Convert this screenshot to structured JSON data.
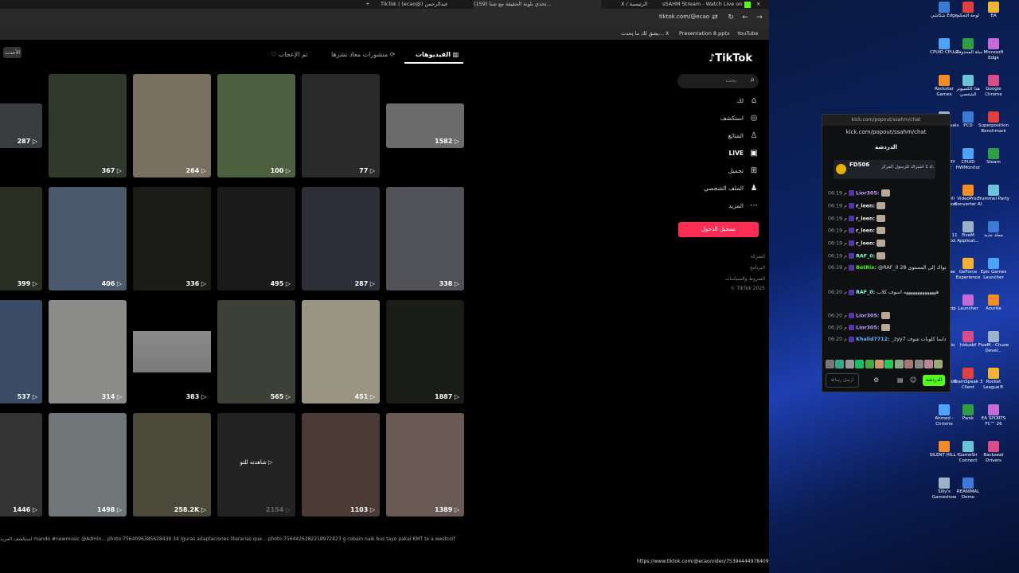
{
  "browser": {
    "tabs": [
      {
        "label": "TikTok | (ecao@) عبدالرحمن",
        "active": false
      },
      {
        "label": "(159) تحدي بلونة الحقيقة مع شنا...",
        "active": true
      },
      {
        "label": "X / الرئيسية",
        "active": false
      },
      {
        "label": "sSAHM Stream - Watch Live on",
        "active": false
      }
    ],
    "url": "tiktok.com/@ecao",
    "bookmarks": [
      "YouTube",
      "Presentation 8.pptx",
      "يشق لك ما يحدث... X"
    ],
    "status_url": "https://www.tiktok.com/@ecao/video/7539444497840990074"
  },
  "tiktok": {
    "logo": "TikTok",
    "search_placeholder": "بحث",
    "nav": [
      {
        "label": "لك",
        "icon": "home-icon"
      },
      {
        "label": "استكشف",
        "icon": "compass-icon"
      },
      {
        "label": "المتابَع",
        "icon": "user-follow-icon"
      },
      {
        "label": "LIVE",
        "icon": "live-icon"
      },
      {
        "label": "تحميل",
        "icon": "upload-icon"
      },
      {
        "label": "الملف الشخصي",
        "icon": "profile-icon"
      },
      {
        "label": "المزيد",
        "icon": "more-icon"
      }
    ],
    "login_label": "تسجيل الدخول",
    "footer": [
      "الشركة",
      "البرنامج",
      "الشروط والسياسات",
      "© TikTok 2025"
    ],
    "profile_tabs": {
      "videos": "الفيديوهات",
      "reposts": "منشورات معاد نشرها",
      "liked": "تم الإعجاب",
      "latest": "الأحدث"
    },
    "video_rows": [
      [
        "287",
        "367",
        "264",
        "100",
        "77",
        "1582"
      ],
      [
        "399",
        "406",
        "336",
        "495",
        "287",
        "338"
      ],
      [
        "537",
        "314",
        "383",
        "565",
        "451",
        "1887"
      ],
      [
        "1446",
        "1498",
        "258.2K",
        "2154",
        "1103",
        "1389"
      ]
    ],
    "watch_again_label": "شاهدته للتو",
    "bottom_strip": "استكشف المزيد   mando #newmusic @Admin...   photo:7564096385628439 34   Iguras adaptaciones literarias que...   photo:7564426382218972423   g cobain naik bus tayo pakai KMT   te a westcoif"
  },
  "kick": {
    "title": "sSAHM Stream - Watch Live on",
    "url": "kick.com/popout/ssahm/chat",
    "chat_header": "الدردشة",
    "pinned_user": "FD506",
    "pinned_text": "إهداء 1 اشتراك للرسول المركز",
    "messages": [
      {
        "time": "06:19 م",
        "user": "Lior305:",
        "text": "",
        "color": "#c59cff"
      },
      {
        "time": "06:19 م",
        "user": "r_leen:",
        "text": "",
        "color": "#f2f2f2"
      },
      {
        "time": "06:19 م",
        "user": "r_leen:",
        "text": "",
        "color": "#f2f2f2"
      },
      {
        "time": "06:19 م",
        "user": "r_leen:",
        "text": "",
        "color": "#f2f2f2"
      },
      {
        "time": "06:19 م",
        "user": "r_leen:",
        "text": "",
        "color": "#f2f2f2"
      },
      {
        "time": "06:19 م",
        "user": "RAF_0:",
        "text": "",
        "color": "#86fcd5"
      },
      {
        "time": "06:19 م",
        "user": "BotRix:",
        "text": "@RAF_0 قمت برفع مستواك إلى المستوى 28",
        "color": "#53fc18"
      },
      {
        "time": "06:20 م",
        "user": "RAF_0:",
        "text": "ههههههههههههههه اسوف كلاب",
        "color": "#86fcd5"
      },
      {
        "time": "06:20 م",
        "user": "Lior305:",
        "text": "",
        "color": "#c59cff"
      },
      {
        "time": "06:20 م",
        "user": "Lior305:",
        "text": "",
        "color": "#c59cff"
      },
      {
        "time": "06:20 م",
        "user": "Khalid7712:",
        "text": "_zyy7 دايما كلوبات شوف",
        "color": "#5fb3ff"
      }
    ],
    "send_label": "الدردشة",
    "input_placeholder": "أرسل رسالة"
  },
  "desktop_icons": [
    "شكاشي Edge",
    "لوحة التحكم",
    "EA",
    "CPUID CPU-Z",
    "سلة المحذوفات",
    "Microsoft Edge",
    "Rockstar Games",
    "هذا الكمبيوتر الشخصي",
    "Google Chrome",
    "Marvel Rivals",
    "PCD",
    "Superposition Benchmark",
    "ARMOURY CRATE",
    "CPUID HWMonitor",
    "Steam",
    "Silent Hill f_arabic.exe",
    "VideoProc Converter AI",
    "Trummel Party",
    "Windows 11 pro key.txt",
    "FiveM Applicat...",
    "مجلد جديد",
    "FiveM.exe",
    "GeForce Experience",
    "Epic Games Launcher",
    "hidusbf.zip",
    "Launcher",
    "Azurite",
    "BS Studio",
    "hidusbf",
    "FiveM - Chuze Devel...",
    "BakkesMod",
    "TeamSpeak 3 Client",
    "Rocket League®",
    "Ahmed - Chrome",
    "Pwnk",
    "EA SPORTS FC™ 26",
    "SILENT HILL f",
    "GameSir Connect",
    "Backseat Drivers",
    "Silly's Gameshow",
    "REANIMAL Demo"
  ]
}
